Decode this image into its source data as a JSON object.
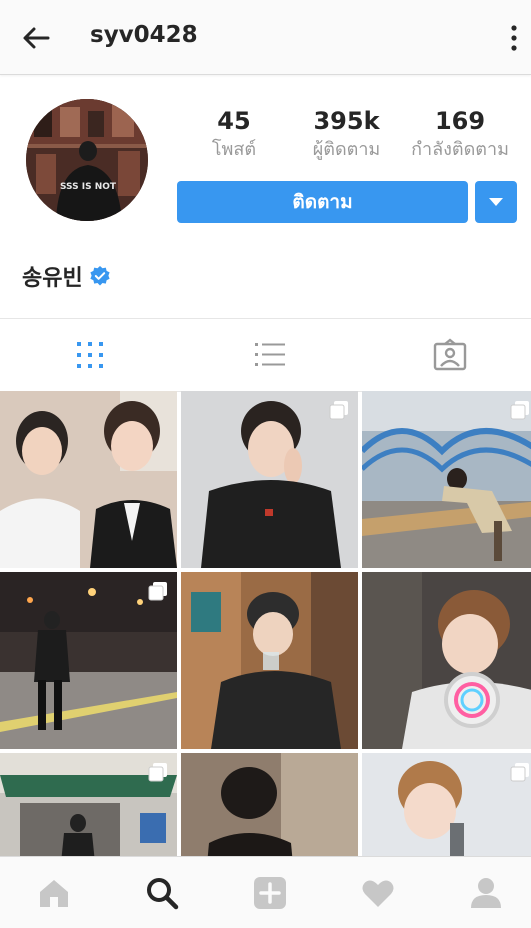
{
  "header": {
    "username": "syv0428"
  },
  "profile": {
    "stats": [
      {
        "value": "45",
        "label": "โพสต์"
      },
      {
        "value": "395k",
        "label": "ผู้ติดตาม"
      },
      {
        "value": "169",
        "label": "กำลังติดตาม"
      }
    ],
    "follow_label": "ติดตาม",
    "display_name": "송유빈",
    "verified": true,
    "avatar_text": "SSS IS NOT"
  },
  "tabs": [
    "grid-view",
    "list-view",
    "tagged-photos"
  ],
  "colors": {
    "accent": "#3897f0",
    "icon_gray": "#999999",
    "text": "#262626"
  },
  "posts": [
    {
      "multi": false
    },
    {
      "multi": true
    },
    {
      "multi": true
    },
    {
      "multi": true
    },
    {
      "multi": false
    },
    {
      "multi": false
    },
    {
      "multi": true
    },
    {
      "multi": false
    },
    {
      "multi": true
    }
  ],
  "bottom_nav": [
    "home",
    "search",
    "add-post",
    "activity",
    "profile"
  ]
}
